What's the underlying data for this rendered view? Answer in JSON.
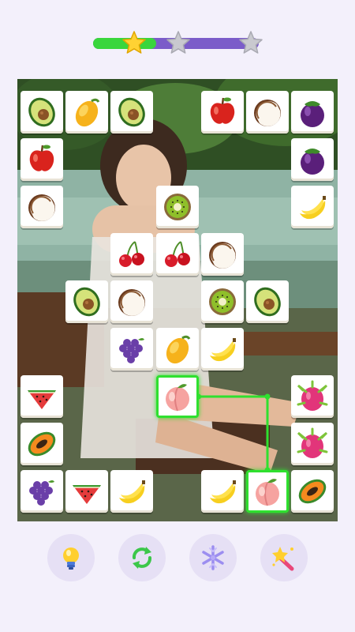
{
  "progress": {
    "fraction": 0.38,
    "stars": [
      {
        "name": "star-1",
        "earned": true
      },
      {
        "name": "star-2",
        "earned": false
      },
      {
        "name": "star-3",
        "earned": false
      }
    ],
    "colors": {
      "fill": "#39d63c",
      "track": "#7b5cc9",
      "star_on": "#ffd233",
      "star_off": "#c9c9cf"
    }
  },
  "board": {
    "columns": 7,
    "rows": 9,
    "background": "girl-on-swing-by-lake-photo",
    "tiles": [
      {
        "fruit": "avocado",
        "col": 0,
        "row": 0
      },
      {
        "fruit": "mango",
        "col": 1,
        "row": 0
      },
      {
        "fruit": "avocado",
        "col": 2,
        "row": 0
      },
      {
        "fruit": "apple",
        "col": 4,
        "row": 0
      },
      {
        "fruit": "coconut",
        "col": 5,
        "row": 0
      },
      {
        "fruit": "mangosteen",
        "col": 6,
        "row": 0
      },
      {
        "fruit": "apple",
        "col": 0,
        "row": 1
      },
      {
        "fruit": "mangosteen",
        "col": 6,
        "row": 1
      },
      {
        "fruit": "coconut",
        "col": 0,
        "row": 2
      },
      {
        "fruit": "kiwi",
        "col": 3,
        "row": 2
      },
      {
        "fruit": "banana",
        "col": 6,
        "row": 2
      },
      {
        "fruit": "cherries",
        "col": 2,
        "row": 3
      },
      {
        "fruit": "cherries",
        "col": 3,
        "row": 3
      },
      {
        "fruit": "coconut",
        "col": 4,
        "row": 3
      },
      {
        "fruit": "avocado",
        "col": 1,
        "row": 4
      },
      {
        "fruit": "coconut",
        "col": 2,
        "row": 4
      },
      {
        "fruit": "kiwi",
        "col": 4,
        "row": 4
      },
      {
        "fruit": "avocado",
        "col": 5,
        "row": 4
      },
      {
        "fruit": "grapes",
        "col": 2,
        "row": 5
      },
      {
        "fruit": "mango",
        "col": 3,
        "row": 5
      },
      {
        "fruit": "banana",
        "col": 4,
        "row": 5
      },
      {
        "fruit": "watermelon",
        "col": 0,
        "row": 6
      },
      {
        "fruit": "peach",
        "col": 3,
        "row": 6,
        "selected": true
      },
      {
        "fruit": "dragonfruit",
        "col": 6,
        "row": 6
      },
      {
        "fruit": "papaya",
        "col": 0,
        "row": 7
      },
      {
        "fruit": "dragonfruit",
        "col": 6,
        "row": 7
      },
      {
        "fruit": "grapes",
        "col": 0,
        "row": 8
      },
      {
        "fruit": "watermelon",
        "col": 1,
        "row": 8
      },
      {
        "fruit": "banana",
        "col": 2,
        "row": 8
      },
      {
        "fruit": "banana",
        "col": 4,
        "row": 8
      },
      {
        "fruit": "peach",
        "col": 5,
        "row": 8,
        "selected": true
      },
      {
        "fruit": "papaya",
        "col": 6,
        "row": 8
      }
    ],
    "match_path": [
      [
        3,
        6
      ],
      [
        5,
        6
      ],
      [
        5,
        8
      ]
    ],
    "highlight_color": "#2fe02f"
  },
  "powerups": [
    {
      "name": "hint-button",
      "icon": "lightbulb-icon"
    },
    {
      "name": "shuffle-button",
      "icon": "shuffle-icon"
    },
    {
      "name": "freeze-button",
      "icon": "snowflake-icon"
    },
    {
      "name": "magic-wand-button",
      "icon": "magic-wand-icon"
    }
  ]
}
